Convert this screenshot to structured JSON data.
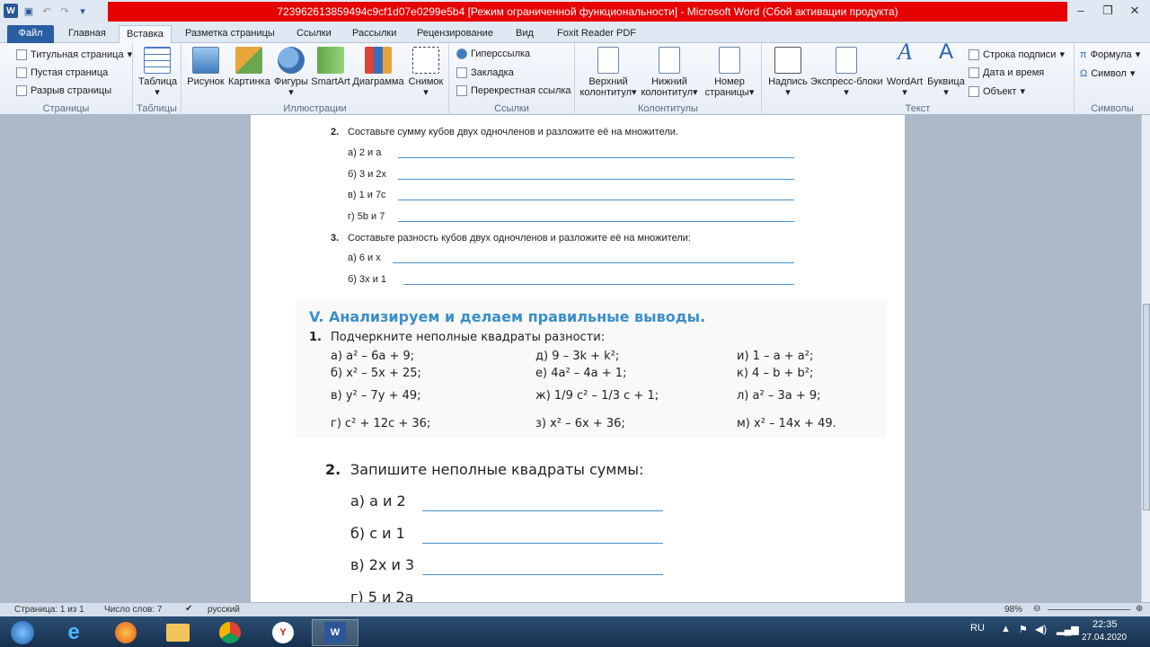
{
  "window": {
    "title": "723962613859494c9cf1d07e0299e5b4 [Режим ограниченной функциональности]  -  Microsoft Word (Сбой активации продукта)"
  },
  "tabs": [
    "Файл",
    "Главная",
    "Вставка",
    "Разметка страницы",
    "Ссылки",
    "Рассылки",
    "Рецензирование",
    "Вид",
    "Foxit Reader PDF"
  ],
  "ribbon": {
    "pages": {
      "items": [
        "Титульная страница",
        "Пустая страница",
        "Разрыв страницы"
      ],
      "label": "Страницы"
    },
    "tables": {
      "button": "Таблица",
      "label": "Таблицы"
    },
    "illustrations": {
      "buttons": [
        "Рисунок",
        "Картинка",
        "Фигуры",
        "SmartArt",
        "Диаграмма",
        "Снимок"
      ],
      "label": "Иллюстрации"
    },
    "links": {
      "items": [
        "Гиперссылка",
        "Закладка",
        "Перекрестная ссылка"
      ],
      "label": "Ссылки"
    },
    "headers": {
      "buttons": [
        [
          "Верхний",
          "колонтитул"
        ],
        [
          "Нижний",
          "колонтитул"
        ],
        [
          "Номер",
          "страницы"
        ]
      ],
      "label": "Колонтитулы"
    },
    "text": {
      "buttons": [
        "Надпись",
        "Экспресс-блоки",
        "WordArt",
        "Буквица"
      ],
      "items": [
        "Строка подписи",
        "Дата и время",
        "Объект"
      ],
      "label": "Текст"
    },
    "symbols": {
      "items": [
        "Формула",
        "Символ"
      ],
      "label": "Символы"
    }
  },
  "doc": {
    "task2": {
      "num": "2.",
      "text": "Составьте сумму кубов двух одночленов и разложите её на множители.",
      "rows": [
        "а) 2 и a",
        "б) 3 и 2x",
        "в) 1 и 7c",
        "г) 5b и 7"
      ]
    },
    "task3": {
      "num": "3.",
      "text": "Составьте разность кубов двух одночленов и разложите её на множители:",
      "rows": [
        "а) 6 и x",
        "б) 3x и 1"
      ]
    },
    "section": "V. Анализируем и делаем правильные выводы.",
    "q1": {
      "num": "1.",
      "text": "Подчеркните неполные квадраты разности:",
      "col1": [
        "а) a² – 6a + 9;",
        "б) x² – 5x + 25;",
        "в) y² – 7y + 49;",
        "г) c² + 12c + 36;"
      ],
      "col2": [
        "д) 9 – 3k + k²;",
        "е) 4a² – 4a + 1;",
        "ж) 1/9 c² – 1/3 c + 1;",
        "з) x² – 6x + 36;"
      ],
      "col3": [
        "и) 1 – a + a²;",
        "к) 4 – b + b²;",
        "л) a² – 3a + 9;",
        "м) x² – 14x + 49."
      ]
    },
    "q2": {
      "num": "2.",
      "text": "Запишите неполные квадраты суммы:",
      "rows": [
        "а) a и 2",
        "б) c и 1",
        "в) 2x и 3",
        "г) 5 и 2a"
      ]
    }
  },
  "status": {
    "page": "Страница: 1 из 1",
    "words": "Число слов: 7",
    "lang": "русский",
    "zoom": "98%"
  },
  "tray": {
    "lang": "RU",
    "time": "22:35",
    "date": "27.04.2020"
  }
}
